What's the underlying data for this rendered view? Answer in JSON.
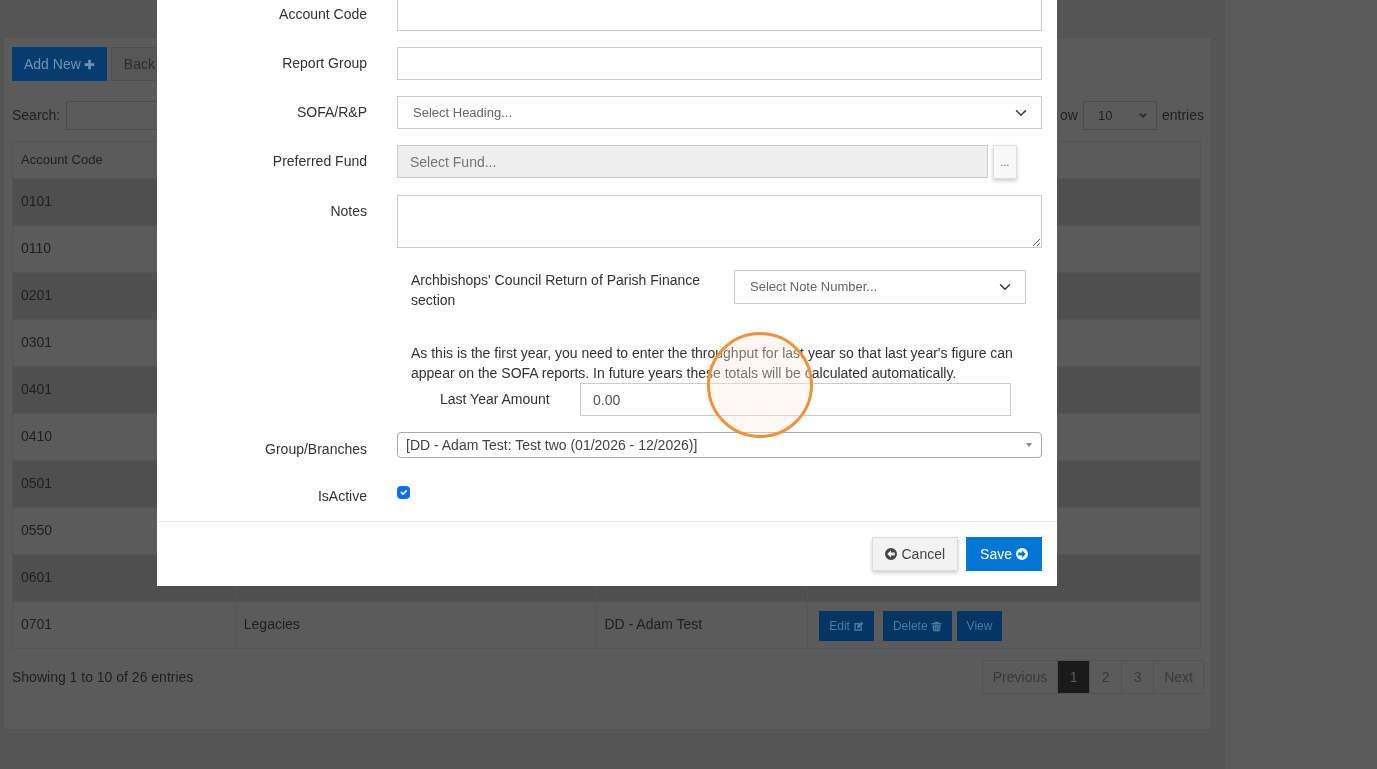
{
  "background": {
    "toolbar": [
      {
        "kind": "add",
        "label": "Add New"
      },
      {
        "kind": "back",
        "label": "Back"
      }
    ],
    "search": {
      "label": "Search:"
    },
    "length": {
      "label_start": "ow",
      "value": "10",
      "label_end": "entries"
    },
    "table": {
      "columns": [
        "Account Code"
      ],
      "rows": [
        {
          "code": "0101"
        },
        {
          "code": "0110"
        },
        {
          "code": "0201"
        },
        {
          "code": "0301"
        },
        {
          "code": "0401"
        },
        {
          "code": "0410"
        },
        {
          "code": "0501"
        },
        {
          "code": "0550"
        },
        {
          "code": "0601"
        },
        {
          "code": "0701",
          "name": "Legacies",
          "group": "DD - Adam Test",
          "actions": [
            {
              "kind": "edit",
              "label": "Edit"
            },
            {
              "kind": "delete",
              "label": "Delete"
            },
            {
              "kind": "view",
              "label": "View"
            }
          ]
        }
      ]
    },
    "info": "Showing 1 to 10 of 26 entries",
    "pagination": {
      "previous": "Previous",
      "pages": [
        {
          "label": "1",
          "selected": true
        },
        {
          "label": "2",
          "selected": false
        },
        {
          "label": "3",
          "selected": false
        }
      ],
      "next": "Next"
    }
  },
  "modal": {
    "fields": [
      {
        "kind": "text",
        "label": "Account Code"
      },
      {
        "kind": "text",
        "label": "Report Group"
      },
      {
        "kind": "select",
        "label": "SOFA/R&P",
        "placeholder": "Select Heading..."
      },
      {
        "kind": "picker",
        "label": "Preferred Fund",
        "placeholder": "Select Fund...",
        "button": "..."
      },
      {
        "kind": "textarea",
        "label": "Notes"
      }
    ],
    "return_section": {
      "label": "Archbishops' Council Return of Parish Finance section",
      "placeholder": "Select Note Number..."
    },
    "first_year_note": "As this is the first year, you need to enter the throughput for last year so that last year's figure can appear on the SOFA reports. In future years these totals will be calculated automatically.",
    "last_year": {
      "label": "Last Year Amount",
      "value": "0.00"
    },
    "group": {
      "label": "Group/Branches",
      "value": "[DD - Adam Test: Test two (01/2026 - 12/2026)]"
    },
    "active": {
      "label": "IsActive",
      "checked": true
    },
    "buttons": [
      {
        "kind": "cancel",
        "label": "Cancel"
      },
      {
        "kind": "save",
        "label": "Save"
      }
    ]
  },
  "click_indicator": true
}
